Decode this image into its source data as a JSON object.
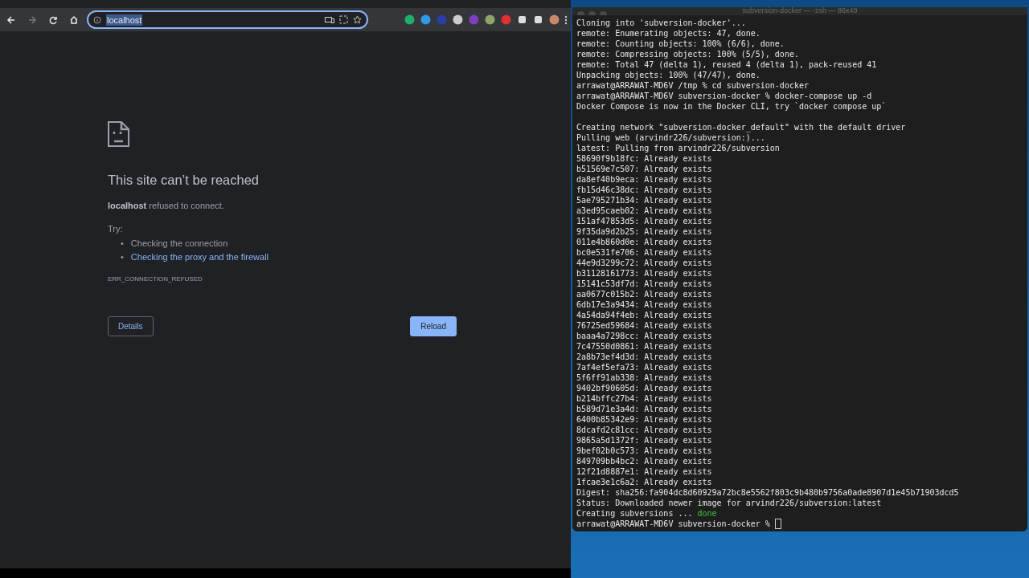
{
  "browser": {
    "address": "localhost",
    "address_selected": true,
    "error": {
      "title": "This site can’t be reached",
      "message": "**localhost** refused to connect.",
      "try_label": "Try:",
      "suggestions": [
        {
          "bullet": "•",
          "text": "Checking the connection",
          "kind": "plain"
        },
        {
          "bullet": "•",
          "text": "Checking the proxy and the firewall",
          "kind": "link"
        }
      ],
      "code": "ERR_CONNECTION_REFUSED",
      "buttons": [
        {
          "label": "Details",
          "kind": "secondary"
        },
        {
          "label": "Reload",
          "kind": "primary"
        }
      ]
    }
  },
  "terminal": {
    "title": "subversion-docker — -zsh — 86x49",
    "lines": [
      {
        "text": "Cloning into 'subversion-docker'..."
      },
      {
        "text": "remote: Enumerating objects: 47, done."
      },
      {
        "text": "remote: Counting objects: 100% (6/6), done."
      },
      {
        "text": "remote: Compressing objects: 100% (5/5), done."
      },
      {
        "text": "remote: Total 47 (delta 1), reused 4 (delta 1), pack-reused 41"
      },
      {
        "text": "Unpacking objects: 100% (47/47), done."
      },
      {
        "text": "arrawat@ARRAWAT-MD6V /tmp % cd subversion-docker"
      },
      {
        "text": "arrawat@ARRAWAT-MD6V subversion-docker % docker-compose up -d"
      },
      {
        "text": "Docker Compose is now in the Docker CLI, try `docker compose up`"
      },
      {
        "gap_before": true,
        "text": "Creating network \"subversion-docker_default\" with the default driver"
      },
      {
        "text": "Pulling web (arvindr226/subversion:)..."
      },
      {
        "text": "latest: Pulling from arvindr226/subversion"
      },
      {
        "text": "58690f9b18fc: Already exists"
      },
      {
        "text": "b51569e7c507: Already exists"
      },
      {
        "text": "da8ef40b9eca: Already exists"
      },
      {
        "text": "fb15d46c38dc: Already exists"
      },
      {
        "text": "5ae795271b34: Already exists"
      },
      {
        "text": "a3ed95caeb02: Already exists"
      },
      {
        "text": "151af47853d5: Already exists"
      },
      {
        "text": "9f35da9d2b25: Already exists"
      },
      {
        "text": "011e4b860d0e: Already exists"
      },
      {
        "text": "bc0e531fe706: Already exists"
      },
      {
        "text": "44e9d3299c72: Already exists"
      },
      {
        "text": "b31128161773: Already exists"
      },
      {
        "text": "15141c53df7d: Already exists"
      },
      {
        "text": "aa0677c015b2: Already exists"
      },
      {
        "text": "6db17e3a9434: Already exists"
      },
      {
        "text": "4a54da94f4eb: Already exists"
      },
      {
        "text": "76725ed59684: Already exists"
      },
      {
        "text": "baaa4a7298cc: Already exists"
      },
      {
        "text": "7c47550d0861: Already exists"
      },
      {
        "text": "2a8b73ef4d3d: Already exists"
      },
      {
        "text": "7af4ef5efa73: Already exists"
      },
      {
        "text": "5f6ff91ab338: Already exists"
      },
      {
        "text": "9402bf90605d: Already exists"
      },
      {
        "text": "b214bffc27b4: Already exists"
      },
      {
        "text": "b589d71e3a4d: Already exists"
      },
      {
        "text": "6400b85342e9: Already exists"
      },
      {
        "text": "8dcafd2c81cc: Already exists"
      },
      {
        "text": "9865a5d1372f: Already exists"
      },
      {
        "text": "9bef02b0c573: Already exists"
      },
      {
        "text": "849709bb4bc2: Already exists"
      },
      {
        "text": "12f21d8887e1: Already exists"
      },
      {
        "text": "1fcae3e1c6a2: Already exists"
      },
      {
        "text": "Digest: sha256:fa904dc8d60929a72bc8e5562f803c9b480b9756a0ade8907d1e45b71903dcd5"
      },
      {
        "text": "Status: Downloaded newer image for arvindr226/subversion:latest"
      },
      {
        "text": "Creating subversions ... ",
        "status": "done"
      },
      {
        "text": "arrawat@ARRAWAT-MD6V subversion-docker % ",
        "cursor": true
      }
    ]
  }
}
